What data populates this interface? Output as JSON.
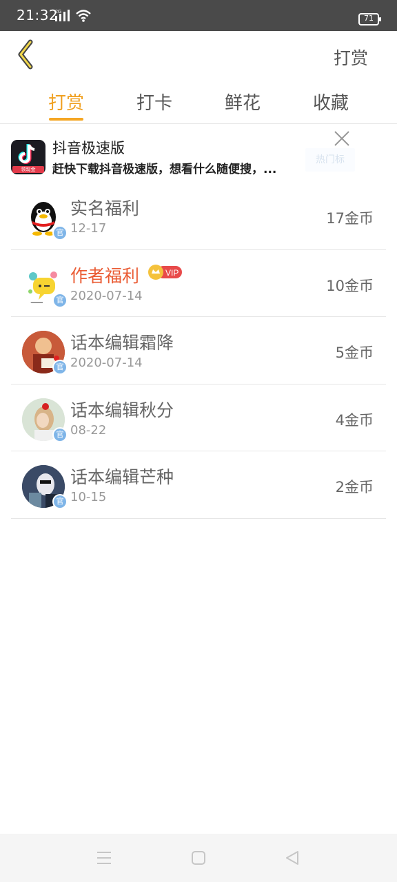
{
  "status": {
    "time": "21:32",
    "network": "2G",
    "battery": "71"
  },
  "header": {
    "title": "打赏"
  },
  "tabs": [
    {
      "label": "打赏",
      "active": true
    },
    {
      "label": "打卡",
      "active": false
    },
    {
      "label": "鲜花",
      "active": false
    },
    {
      "label": "收藏",
      "active": false
    }
  ],
  "ad": {
    "title": "抖音极速版",
    "description": "赶快下载抖音极速版，想看什么随便搜，...",
    "icon_badge": "领现金",
    "button_label": "热门标"
  },
  "rewards": [
    {
      "name": "实名福利",
      "date": "12-17",
      "amount": "17金币",
      "vip": false,
      "badge": "官"
    },
    {
      "name": "作者福利",
      "date": "2020-07-14",
      "amount": "10金币",
      "vip": true,
      "vip_label": "VIP",
      "badge": "官"
    },
    {
      "name": "话本编辑霜降",
      "date": "2020-07-14",
      "amount": "5金币",
      "vip": false,
      "badge": "官"
    },
    {
      "name": "话本编辑秋分",
      "date": "08-22",
      "amount": "4金币",
      "vip": false,
      "badge": "官"
    },
    {
      "name": "话本编辑芒种",
      "date": "10-15",
      "amount": "2金币",
      "vip": false,
      "badge": "官"
    }
  ],
  "colors": {
    "accent": "#f5a623",
    "highlight_name": "#ea5b33",
    "official_badge": "#7fb5e8"
  },
  "icons": [
    "back-arrow-icon",
    "close-icon",
    "menu-icon",
    "home-icon",
    "back-triangle-icon"
  ]
}
